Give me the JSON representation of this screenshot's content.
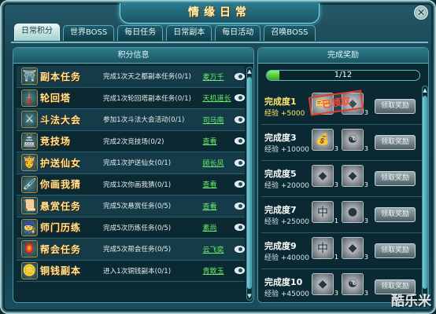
{
  "window": {
    "title": "情缘日常"
  },
  "tabs": [
    {
      "label": "日常积分",
      "active": true
    },
    {
      "label": "世界BOSS",
      "active": false
    },
    {
      "label": "每日任务",
      "active": false
    },
    {
      "label": "日常副本",
      "active": false
    },
    {
      "label": "每日活动",
      "active": false
    },
    {
      "label": "召唤BOSS",
      "active": false
    }
  ],
  "left_panel": {
    "header": "积分信息",
    "tasks": [
      {
        "name": "副本任务",
        "icon": "temple-icon",
        "glyph": "⛩",
        "desc": "完成1次天之都副本任务(0/1)",
        "link": "麦万千"
      },
      {
        "name": "轮回塔",
        "icon": "tower-icon",
        "glyph": "🗼",
        "desc": "完成1次轮回塔副本任务(0/1)",
        "link": "天机道长"
      },
      {
        "name": "斗法大会",
        "icon": "swords-icon",
        "glyph": "⚔",
        "desc": "参加1次斗法大会活动(0/1)",
        "link": "司马南"
      },
      {
        "name": "竞技场",
        "icon": "arena-icon",
        "glyph": "🏯",
        "desc": "完成2次竞技场(0/2)",
        "link": "查看"
      },
      {
        "name": "护送仙女",
        "icon": "fairy-icon",
        "glyph": "👸",
        "desc": "完成1次护送仙女(0/1)",
        "link": "顾长风"
      },
      {
        "name": "你画我猜",
        "icon": "painting-icon",
        "glyph": "🖌",
        "desc": "完成1次你画我猜(0/1)",
        "link": "查看"
      },
      {
        "name": "悬赏任务",
        "icon": "scroll-icon",
        "glyph": "📜",
        "desc": "完成5次悬赏任务(0/5)",
        "link": "查看"
      },
      {
        "name": "师门历练",
        "icon": "master-icon",
        "glyph": "🧙",
        "desc": "完成5次历练任务(0/5)",
        "link": "素尚"
      },
      {
        "name": "帮会任务",
        "icon": "guild-icon",
        "glyph": "🏮",
        "desc": "完成5次帮会任务(0/5)",
        "link": "云飞奕"
      },
      {
        "name": "铜钱副本",
        "icon": "coin-icon",
        "glyph": "🪙",
        "desc": "进入1次铜钱副本(0/1)",
        "link": "青致玉"
      }
    ]
  },
  "right_panel": {
    "header": "完成奖励",
    "progress": {
      "text": "1/12",
      "fraction": 0.083
    },
    "claimed_stamp": "已领取",
    "rewards": [
      {
        "title": "完成度1",
        "exp": "经验 +5000",
        "button": "领取奖励",
        "current": true,
        "items": [
          {
            "icon": "ticket-icon",
            "glyph": "🎫",
            "count": ""
          },
          {
            "icon": "gem-icon",
            "glyph": "◆",
            "count": "3"
          }
        ]
      },
      {
        "title": "完成度3",
        "exp": "经验 +10000",
        "button": "领取奖励",
        "current": false,
        "items": [
          {
            "icon": "coin-bag-icon",
            "glyph": "💰",
            "count": "3"
          },
          {
            "icon": "talisman-icon",
            "glyph": "☯",
            "count": "3"
          }
        ]
      },
      {
        "title": "完成度5",
        "exp": "经验 +20000",
        "button": "领取奖励",
        "current": false,
        "items": [
          {
            "icon": "stone-icon",
            "glyph": "◆",
            "count": "3"
          },
          {
            "icon": "stone-icon",
            "glyph": "◆",
            "count": "3"
          }
        ]
      },
      {
        "title": "完成度7",
        "exp": "经验 +25000",
        "button": "领取奖励",
        "current": false,
        "items": [
          {
            "icon": "stone-mid-icon",
            "glyph": "中",
            "count": "1"
          },
          {
            "icon": "pearl-icon",
            "glyph": "●",
            "count": "3"
          }
        ]
      },
      {
        "title": "完成度9",
        "exp": "经验 +40000",
        "button": "领取奖励",
        "current": false,
        "items": [
          {
            "icon": "stone-mid-icon",
            "glyph": "中",
            "count": "1"
          },
          {
            "icon": "stone-icon",
            "glyph": "◆",
            "count": "3"
          }
        ]
      },
      {
        "title": "完成度10",
        "exp": "经验 +45000",
        "button": "领取奖励",
        "current": false,
        "items": [
          {
            "icon": "stone-icon",
            "glyph": "◆",
            "count": "3"
          },
          {
            "icon": "talisman-icon",
            "glyph": "☯",
            "count": "3"
          }
        ]
      }
    ]
  },
  "watermark": "酷乐米"
}
